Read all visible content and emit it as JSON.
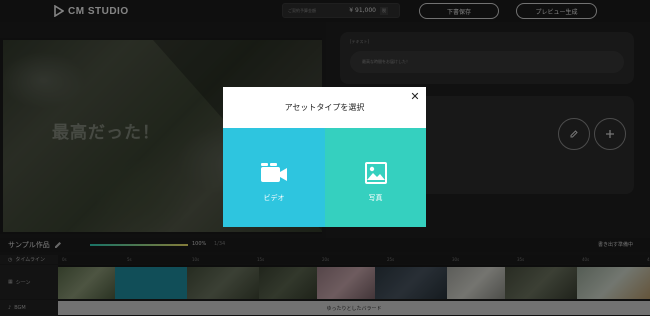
{
  "header": {
    "logo_text": "CM STUDIO",
    "budget_label": "ご契約予算金額",
    "budget_value": "¥ 91,000",
    "budget_unit": "税",
    "save_label": "下書保存",
    "preview_label": "プレビュー生成"
  },
  "preview": {
    "caption": "最高だった！"
  },
  "text_panel": {
    "field_label": "[テキスト]",
    "input_placeholder": "最高な時間をお届けした！"
  },
  "project": {
    "title": "サンプル作品",
    "progress_percent": 100,
    "progress_text": "100%",
    "progress_extra": "1/34",
    "right_label": "書き出す準備中"
  },
  "timeline": {
    "time_label": "タイムライン",
    "scene_label": "シーン",
    "bgm_label": "BGM",
    "bgm_track": "ゆったりとしたバラード",
    "ticks": [
      "0s",
      "5s",
      "10s",
      "15s",
      "20s",
      "25s",
      "30s",
      "35s",
      "40s",
      "45s"
    ]
  },
  "modal": {
    "title": "アセットタイプを選択",
    "close_glyph": "✕",
    "video_label": "ビデオ",
    "photo_label": "写真"
  },
  "colors": {
    "video_tile": "#2ec5df",
    "photo_tile": "#35d0bf",
    "overlay": "rgba(0,0,0,0.45)"
  },
  "icons": {
    "logo": "play-triangle-logo",
    "video": "video-camera-icon",
    "photo": "image-icon",
    "edit": "edit-icon",
    "add": "plus-icon",
    "close": "close-icon",
    "pencil": "pencil-icon"
  }
}
